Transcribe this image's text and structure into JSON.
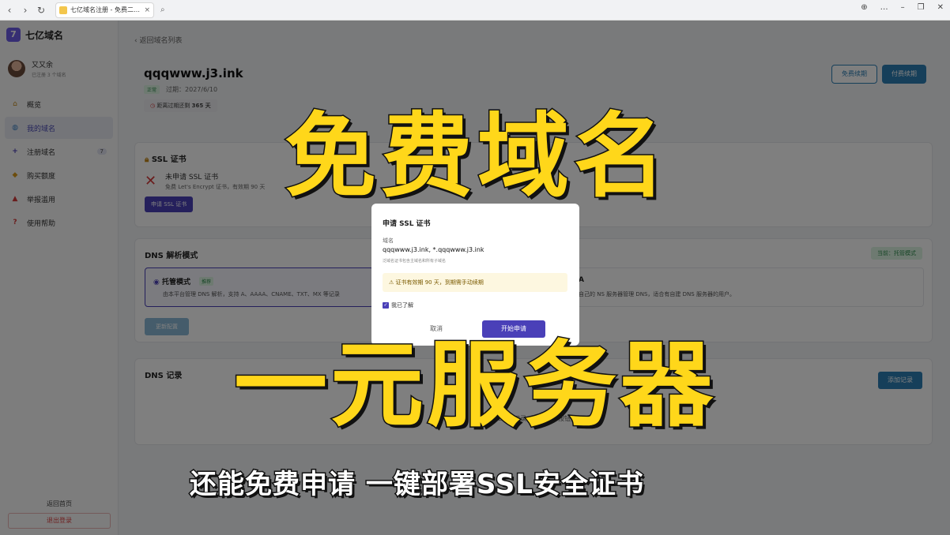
{
  "browser": {
    "tab_title": "七亿域名注册 - 免费二级域名",
    "tab_close": "×",
    "nav": [
      "‹",
      "›",
      "↻"
    ],
    "search_icon": "search-icon",
    "controls": [
      "⊕",
      "…",
      "–",
      "❐",
      "✕"
    ]
  },
  "brand": {
    "logo": "7",
    "name": "七亿域名"
  },
  "user": {
    "name": "又又余",
    "subtitle": "已注册 3 个域名"
  },
  "menu": [
    {
      "icon": "⌂",
      "label": "概览",
      "active": false
    },
    {
      "icon": "◍",
      "label": "我的域名",
      "active": true
    },
    {
      "icon": "+",
      "label": "注册域名",
      "badge": "7"
    },
    {
      "icon": "◆",
      "label": "购买额度"
    },
    {
      "icon": "▲",
      "label": "举报滥用"
    },
    {
      "icon": "?",
      "label": "使用帮助"
    }
  ],
  "sidebar_bottom": {
    "home": "返回首页",
    "logout": "退出登录"
  },
  "main": {
    "back": "‹ 返回域名列表",
    "domain": "qqqwww.j3.ink",
    "status_badge": "正常",
    "expire": "过期：2027/6/10",
    "expire_remaining_prefix": "距离过期还剩",
    "expire_remaining_days": "365 天",
    "btn_free_renew": "免费续期",
    "btn_paid_renew": "付费续期"
  },
  "ssl": {
    "title": "SSL 证书",
    "status": "未申请 SSL 证书",
    "desc": "免费 Let's Encrypt 证书，有效期 90 天",
    "button": "申请 SSL 证书"
  },
  "dns_mode": {
    "title": "DNS 解析模式",
    "current": "当前：托管模式",
    "opt1_title": "托管模式",
    "opt1_rec": "推荐",
    "opt1_desc": "由本平台管理 DNS 解析，支持 A、AAAA、CNAME、TXT、MX 等记录",
    "opt2_title": "A",
    "opt2_desc": "自己的 NS 服务器管理 DNS，适合有自建 DNS 服务器的用户。",
    "button": "更新配置"
  },
  "dns_records": {
    "title": "DNS 记录",
    "button": "添加记录",
    "empty": "暂无 DNS 记录，点击上方按钮添加"
  },
  "modal": {
    "title": "申请 SSL 证书",
    "label": "域名",
    "value": "qqqwww.j3.ink, *.qqqwww.j3.ink",
    "hint": "泛域名证书包含主域名和所有子域名",
    "warn": "⚠ 证书有效期 90 天，到期需手动续期",
    "check": "我已了解",
    "cancel": "取消",
    "start": "开始申请"
  },
  "captions": {
    "line1": "免费域名",
    "line2": "一元服务器",
    "line3": "还能免费申请 一键部署SSL安全证书"
  }
}
